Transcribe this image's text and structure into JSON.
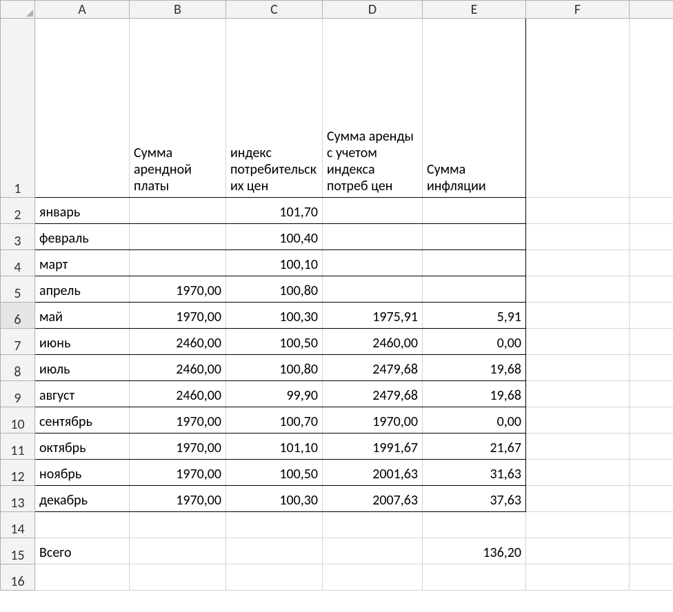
{
  "columns": [
    "A",
    "B",
    "C",
    "D",
    "E",
    "F"
  ],
  "row_numbers": [
    1,
    2,
    3,
    4,
    5,
    6,
    7,
    8,
    9,
    10,
    11,
    12,
    13,
    14,
    15,
    16
  ],
  "headers": {
    "A": "",
    "B": "Сумма арендной платы",
    "C": "индекс потребительских цен",
    "D": "Сумма аренды с учетом индекса потреб цен",
    "E": "Сумма инфляции"
  },
  "rows": [
    {
      "A": "январь",
      "B": "",
      "C": "101,70",
      "D": "",
      "E": ""
    },
    {
      "A": "февраль",
      "B": "",
      "C": "100,40",
      "D": "",
      "E": ""
    },
    {
      "A": "март",
      "B": "",
      "C": "100,10",
      "D": "",
      "E": ""
    },
    {
      "A": "апрель",
      "B": "1970,00",
      "C": "100,80",
      "D": "",
      "E": ""
    },
    {
      "A": "май",
      "B": "1970,00",
      "C": "100,30",
      "D": "1975,91",
      "E": "5,91"
    },
    {
      "A": "июнь",
      "B": "2460,00",
      "C": "100,50",
      "D": "2460,00",
      "E": "0,00"
    },
    {
      "A": "июль",
      "B": "2460,00",
      "C": "100,80",
      "D": "2479,68",
      "E": "19,68"
    },
    {
      "A": "август",
      "B": "2460,00",
      "C": "99,90",
      "D": "2479,68",
      "E": "19,68"
    },
    {
      "A": "сентябрь",
      "B": "1970,00",
      "C": "100,70",
      "D": "1970,00",
      "E": "0,00"
    },
    {
      "A": "октябрь",
      "B": "1970,00",
      "C": "101,10",
      "D": "1991,67",
      "E": "21,67"
    },
    {
      "A": "ноябрь",
      "B": "1970,00",
      "C": "100,50",
      "D": "2001,63",
      "E": "31,63"
    },
    {
      "A": "декабрь",
      "B": "1970,00",
      "C": "100,30",
      "D": "2007,63",
      "E": "37,63"
    }
  ],
  "totals_row": {
    "A": "Всего",
    "E": "136,20"
  },
  "selected_row": 6
}
